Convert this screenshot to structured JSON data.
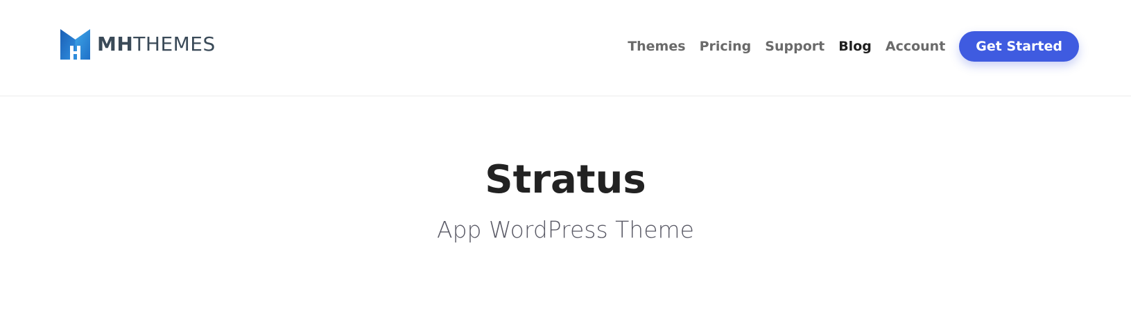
{
  "header": {
    "logo": {
      "brand_strong": "MH",
      "brand_light": "THEMES",
      "mark_icon": "mhthemes-logo-mark-icon"
    },
    "nav": {
      "items": [
        {
          "label": "Themes",
          "active": false
        },
        {
          "label": "Pricing",
          "active": false
        },
        {
          "label": "Support",
          "active": false
        },
        {
          "label": "Blog",
          "active": true
        },
        {
          "label": "Account",
          "active": false
        }
      ],
      "cta_label": "Get Started"
    }
  },
  "hero": {
    "title": "Stratus",
    "subtitle": "App WordPress Theme"
  },
  "colors": {
    "accent": "#3f5be0",
    "logo_blue_dark": "#1b5fb5",
    "logo_blue_light": "#3fa7e8",
    "text_dark": "#222222",
    "nav_text": "#6a6a6a"
  }
}
